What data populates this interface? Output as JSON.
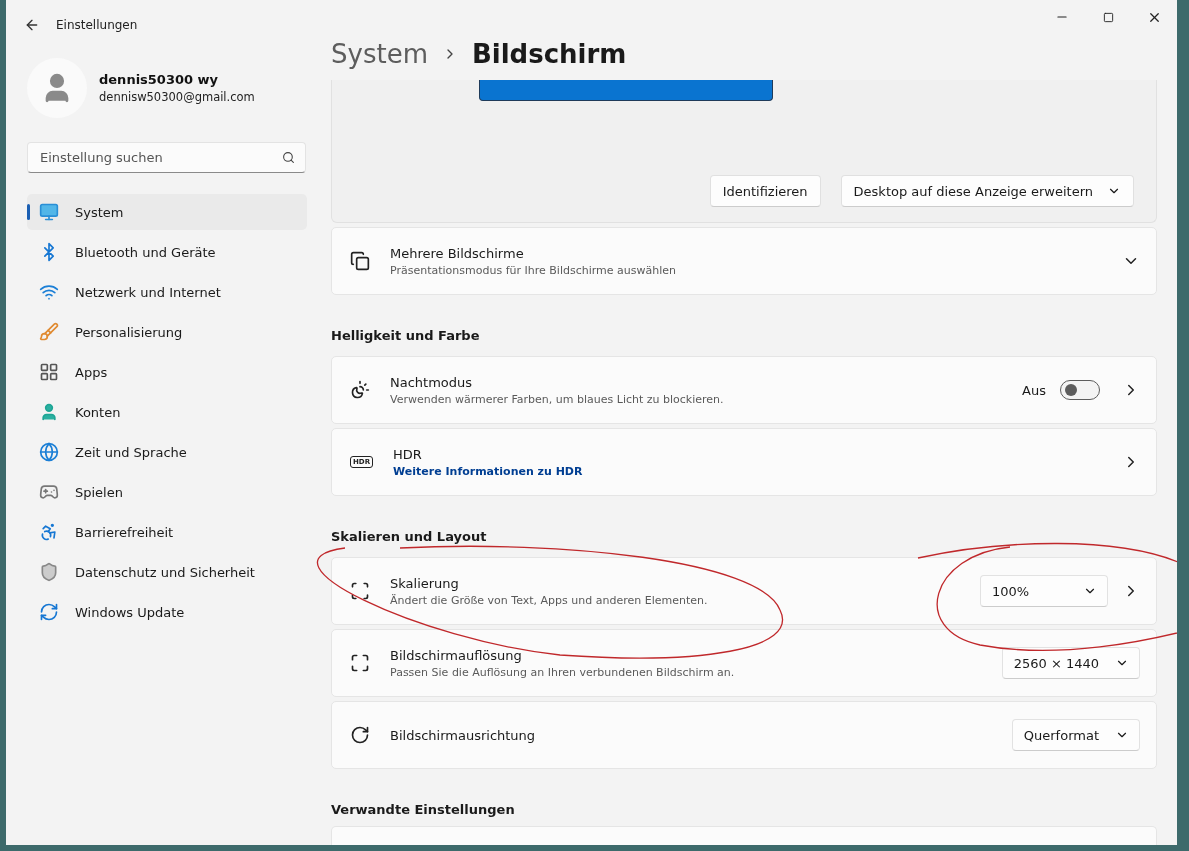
{
  "window": {
    "title": "Einstellungen"
  },
  "user": {
    "name": "dennis50300 wy",
    "email": "dennisw50300@gmail.com"
  },
  "search": {
    "placeholder": "Einstellung suchen"
  },
  "nav": [
    {
      "label": "System",
      "kind": "system",
      "selected": true
    },
    {
      "label": "Bluetooth und Geräte",
      "kind": "bluetooth",
      "selected": false
    },
    {
      "label": "Netzwerk und Internet",
      "kind": "network",
      "selected": false
    },
    {
      "label": "Personalisierung",
      "kind": "brush",
      "selected": false
    },
    {
      "label": "Apps",
      "kind": "apps",
      "selected": false
    },
    {
      "label": "Konten",
      "kind": "accounts",
      "selected": false
    },
    {
      "label": "Zeit und Sprache",
      "kind": "time",
      "selected": false
    },
    {
      "label": "Spielen",
      "kind": "gaming",
      "selected": false
    },
    {
      "label": "Barrierefreiheit",
      "kind": "accessibility",
      "selected": false
    },
    {
      "label": "Datenschutz und Sicherheit",
      "kind": "privacy",
      "selected": false
    },
    {
      "label": "Windows Update",
      "kind": "update",
      "selected": false
    }
  ],
  "breadcrumb": {
    "parent": "System",
    "current": "Bildschirm"
  },
  "display_card": {
    "identify": "Identifizieren",
    "mode": "Desktop auf diese Anzeige erweitern"
  },
  "sections": [
    {
      "rows": [
        {
          "kind": "monitors",
          "title": "Mehrere Bildschirme",
          "subtitle": "Präsentationsmodus für Ihre Bildschirme auswählen",
          "expandable": true,
          "navigates": false
        }
      ]
    },
    {
      "heading": "Helligkeit und Farbe",
      "rows": [
        {
          "kind": "night",
          "title": "Nachtmodus",
          "subtitle": "Verwenden wärmerer Farben, um blaues Licht zu blockieren.",
          "toggle": {
            "label": "Aus",
            "on": false
          },
          "expandable": false,
          "navigates": true
        },
        {
          "kind": "hdr",
          "badge": "HDR",
          "title": "HDR",
          "link": "Weitere Informationen zu HDR",
          "expandable": false,
          "navigates": true
        }
      ]
    },
    {
      "heading": "Skalieren und Layout",
      "rows": [
        {
          "kind": "scale",
          "title": "Skalierung",
          "subtitle": "Ändert die Größe von Text, Apps und anderen Elementen.",
          "dropdown": "100%",
          "expandable": false,
          "navigates": true
        },
        {
          "kind": "resolution",
          "title": "Bildschirmauflösung",
          "subtitle": "Passen Sie die Auflösung an Ihren verbundenen Bildschirm an.",
          "dropdown": "2560 × 1440",
          "expandable": false,
          "navigates": false
        },
        {
          "kind": "orientation",
          "title": "Bildschirmausrichtung",
          "dropdown": "Querformat",
          "expandable": false,
          "navigates": false
        }
      ]
    },
    {
      "heading": "Verwandte Einstellungen"
    }
  ]
}
